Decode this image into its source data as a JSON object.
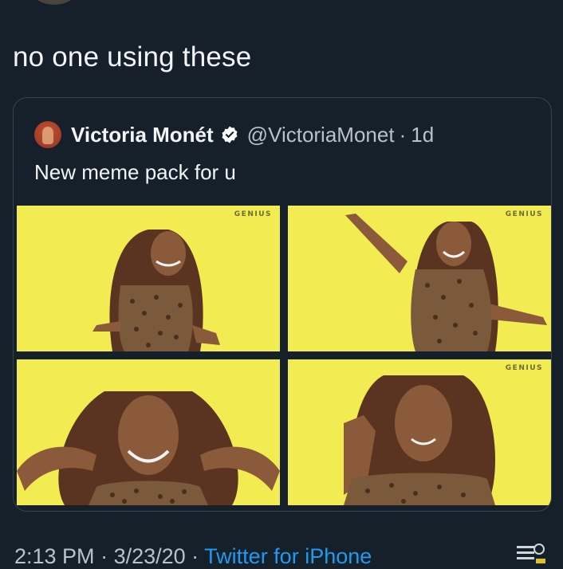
{
  "tweet": {
    "text": "no one using these"
  },
  "quote": {
    "display_name": "Victoria Monét",
    "handle": "@VictoriaMonet",
    "separator": "·",
    "age": "1d",
    "text": "New meme pack for u",
    "media": [
      {
        "watermark": "GENIUS"
      },
      {
        "watermark": "GENIUS"
      },
      {
        "watermark": ""
      },
      {
        "watermark": "GENIUS"
      }
    ]
  },
  "footer": {
    "time": "2:13 PM",
    "separator": " · ",
    "date": "3/23/20",
    "source": "Twitter for iPhone"
  },
  "colors": {
    "background": "#15202b",
    "border": "#38444d",
    "link": "#1d9bf0",
    "media_yellow": "#f2ec52",
    "verified": "#ffffff"
  },
  "icons": {
    "verified": "verified-badge-icon",
    "corner": "app-logo-icon"
  }
}
